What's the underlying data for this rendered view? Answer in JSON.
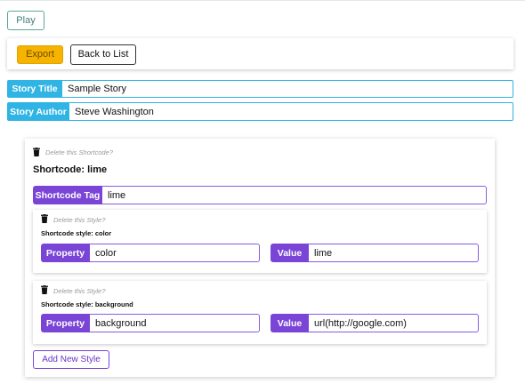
{
  "header": {
    "play_label": "Play"
  },
  "toolbar": {
    "export_label": "Export",
    "back_label": "Back to List"
  },
  "story": {
    "title_label": "Story Title",
    "title_value": "Sample Story",
    "author_label": "Story Author",
    "author_value": "Steve Washington"
  },
  "shortcode": {
    "delete_text": "Delete this Shortcode?",
    "heading": "Shortcode: lime",
    "tag_label": "Shortcode Tag",
    "tag_value": "lime",
    "add_style_label": "Add New Style",
    "styles": [
      {
        "delete_text": "Delete this Style?",
        "heading": "Shortcode style: color",
        "property_label": "Property",
        "property_value": "color",
        "value_label": "Value",
        "value_value": "lime"
      },
      {
        "delete_text": "Delete this Style?",
        "heading": "Shortcode style: background",
        "property_label": "Property",
        "property_value": "background",
        "value_label": "Value",
        "value_value": "url(http://google.com)"
      }
    ]
  },
  "colors": {
    "accent_blue": "#2fb4e4",
    "accent_purple": "#7a45d6",
    "export_yellow": "#f6b400",
    "play_teal": "#5aa79a"
  },
  "icons": {
    "delete": "trash-icon"
  }
}
